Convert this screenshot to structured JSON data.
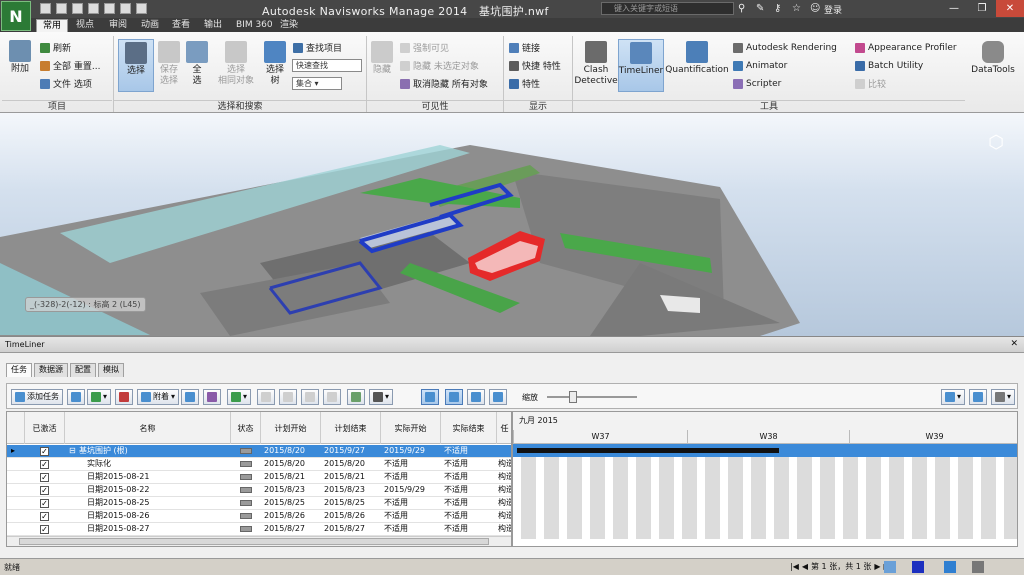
{
  "title_bar": {
    "app_title": "Autodesk Navisworks Manage 2014",
    "file_name": "基坑围护.nwf",
    "search_placeholder": "键入关键字或短语",
    "login_label": "登录",
    "app_button_letter": "N"
  },
  "ribbon_tabs": [
    "常用",
    "视点",
    "审阅",
    "动画",
    "查看",
    "输出",
    "BIM 360",
    "渲染"
  ],
  "ribbon": {
    "project": {
      "label": "项目",
      "attach": "附加",
      "refresh": "刷新",
      "reset_all": "全部 重置...",
      "file_options": "文件 选项"
    },
    "select_search": {
      "label": "选择和搜索",
      "select": "选择",
      "save_selection": "保存\n选择",
      "select_all": "全\n选",
      "select_same": "选择\n相同对象",
      "selection_tree": "选择\n树",
      "find_items": "查找项目",
      "quick_find_placeholder": "快速查找",
      "sets_value": "集合"
    },
    "visibility": {
      "label": "可见性",
      "hide": "隐藏",
      "require": "强制可见",
      "hide_unselected": "隐藏 未选定对象",
      "unhide_all": "取消隐藏 所有对象"
    },
    "display": {
      "label": "显示",
      "links": "链接",
      "quick_props": "快捷 特性",
      "properties": "特性"
    },
    "tools": {
      "label": "工具",
      "clash_detective": "Clash\nDetective",
      "timeliner": "TimeLiner",
      "quantification": "Quantification",
      "autodesk_rendering": "Autodesk Rendering",
      "animator": "Animator",
      "scripter": "Scripter",
      "appearance_profiler": "Appearance Profiler",
      "batch_utility": "Batch Utility",
      "compare": "比较",
      "datatools": "DataTools"
    }
  },
  "viewport": {
    "coordinate_readout": "_(-328)-2(-12) : 标高 2 (L45)"
  },
  "timeliner": {
    "window_title": "TimeLiner",
    "tabs": [
      "任务",
      "数据源",
      "配置",
      "模拟"
    ],
    "toolbar": {
      "add_task": "添加任务",
      "attach": "附着",
      "zoom_label": "缩放"
    },
    "columns": [
      "已激活",
      "名称",
      "状态",
      "计划开始",
      "计划结束",
      "实际开始",
      "实际结束",
      "任"
    ],
    "rows": [
      {
        "active": true,
        "name": "基坑围护 (根)",
        "plan_start": "2015/8/20",
        "plan_end": "2015/9/27",
        "actual_start": "2015/9/29",
        "actual_end": "不适用",
        "task": "",
        "selected": true
      },
      {
        "active": true,
        "name": "实际化",
        "plan_start": "2015/8/20",
        "plan_end": "2015/8/20",
        "actual_start": "不适用",
        "actual_end": "不适用",
        "task": "构造"
      },
      {
        "active": true,
        "name": "日期2015-08-21",
        "plan_start": "2015/8/21",
        "plan_end": "2015/8/21",
        "actual_start": "不适用",
        "actual_end": "不适用",
        "task": "构造"
      },
      {
        "active": true,
        "name": "日期2015-08-22",
        "plan_start": "2015/8/23",
        "plan_end": "2015/8/23",
        "actual_start": "2015/9/29",
        "actual_end": "不适用",
        "task": "构造"
      },
      {
        "active": true,
        "name": "日期2015-08-25",
        "plan_start": "2015/8/25",
        "plan_end": "2015/8/25",
        "actual_start": "不适用",
        "actual_end": "不适用",
        "task": "构造"
      },
      {
        "active": true,
        "name": "日期2015-08-26",
        "plan_start": "2015/8/26",
        "plan_end": "2015/8/26",
        "actual_start": "不适用",
        "actual_end": "不适用",
        "task": "构造"
      },
      {
        "active": true,
        "name": "日期2015-08-27",
        "plan_start": "2015/8/27",
        "plan_end": "2015/8/27",
        "actual_start": "不适用",
        "actual_end": "不适用",
        "task": "构造"
      }
    ],
    "gantt": {
      "month_label": "九月 2015",
      "weeks": [
        "W37",
        "W38",
        "W39"
      ]
    }
  },
  "status_bar": {
    "left_text": "就绪",
    "page_text": "第 1 张，共 1 张"
  },
  "colors": {
    "selected_row": "#3b8ad9",
    "title_bar": "#474747",
    "ribbon_tab_bar": "#3c3c3c",
    "model_highlight": "#e52a2a",
    "model_blue": "#1f3cc6",
    "model_green": "#2e9e46"
  }
}
